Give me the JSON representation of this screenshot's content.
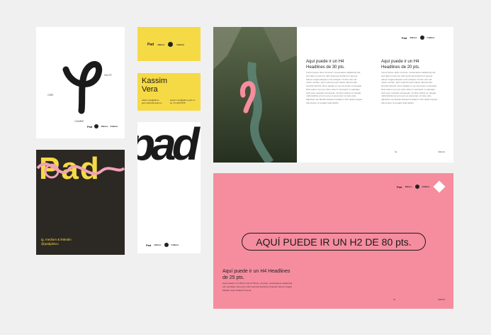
{
  "logo_card": {
    "labels": [
      "SALTE",
      "GIRE",
      "CAMBIE"
    ],
    "brand": [
      "Pad",
      "Jalisco",
      "Cultura"
    ]
  },
  "biz_card_front": {
    "brand": [
      "Pad",
      "Jalisco",
      "Cultura"
    ]
  },
  "biz_card_back": {
    "name_line1": "Kassim",
    "name_line2": "Vera",
    "info_left": "Jalisco.info@jalisco.\ngob.mx@cultura.jal.mx",
    "info_right": "kassim.vera@jalisco.gob.mx\ntel. 33 1234 5678"
  },
  "wordmark_card": {
    "word": "pad",
    "brand": [
      "Pad",
      "Jalisco",
      "Cultura"
    ]
  },
  "poster_card": {
    "word": "Pad",
    "social_line1": "ig, medium & linkedin",
    "social_line2": "@padjalisco"
  },
  "spread": {
    "brand": [
      "Pad",
      "Jalisco",
      "Cultura"
    ],
    "col1_title": "Aquí puede ir un H4 Headlines de 30 pts.",
    "col2_title": "Aquí puede ir un H4 Headlines de 20 pts.",
    "body_text": "Lorem ipsum dolor sit amet, consectetuer adipiscing elit, sed diam nonummy nibh euismod tincidunt ut laoreet dolore magna aliquam erat volutpat. Ut wisi enim ad minim veniam, quis nostrud exerci tation ullamcorper suscipit lobortis nisl ut aliquip ex ea commodo consequat. Duis autem vel eum iriure dolor in hendrerit in vulputate velit esse molestie consequat, vel illum dolore eu feugiat nulla facilisis at vero eros et accumsan et iusto odio dignissim qui blandit praesent luptatum zzril delenit augue duis dolore te feugait nulla facilisi.",
    "page_left": "01",
    "page_right": "INDIAS"
  },
  "pink_card": {
    "brand": [
      "Pad",
      "Jalisco",
      "Cultura"
    ],
    "h2": "AQUÍ PUEDE IR UN H2 DE 80 pts.",
    "h4": "Aquí puede ir un H4 Headlines de 25 pts.",
    "body": "Aquí puede ir un H5 de más al H3 pts, sit amet, consectetuer adipiscing elit, sed diam nonummy nibh euismod tincidunt ut laoreet dolore magna aliquam erat volutpat sit amet.",
    "page_left": "01",
    "page_right": "INDIAS"
  },
  "colors": {
    "yellow": "#f6da45",
    "pink": "#f58d9f",
    "dark": "#2c2823",
    "poster_pink": "#f2a1b8"
  }
}
